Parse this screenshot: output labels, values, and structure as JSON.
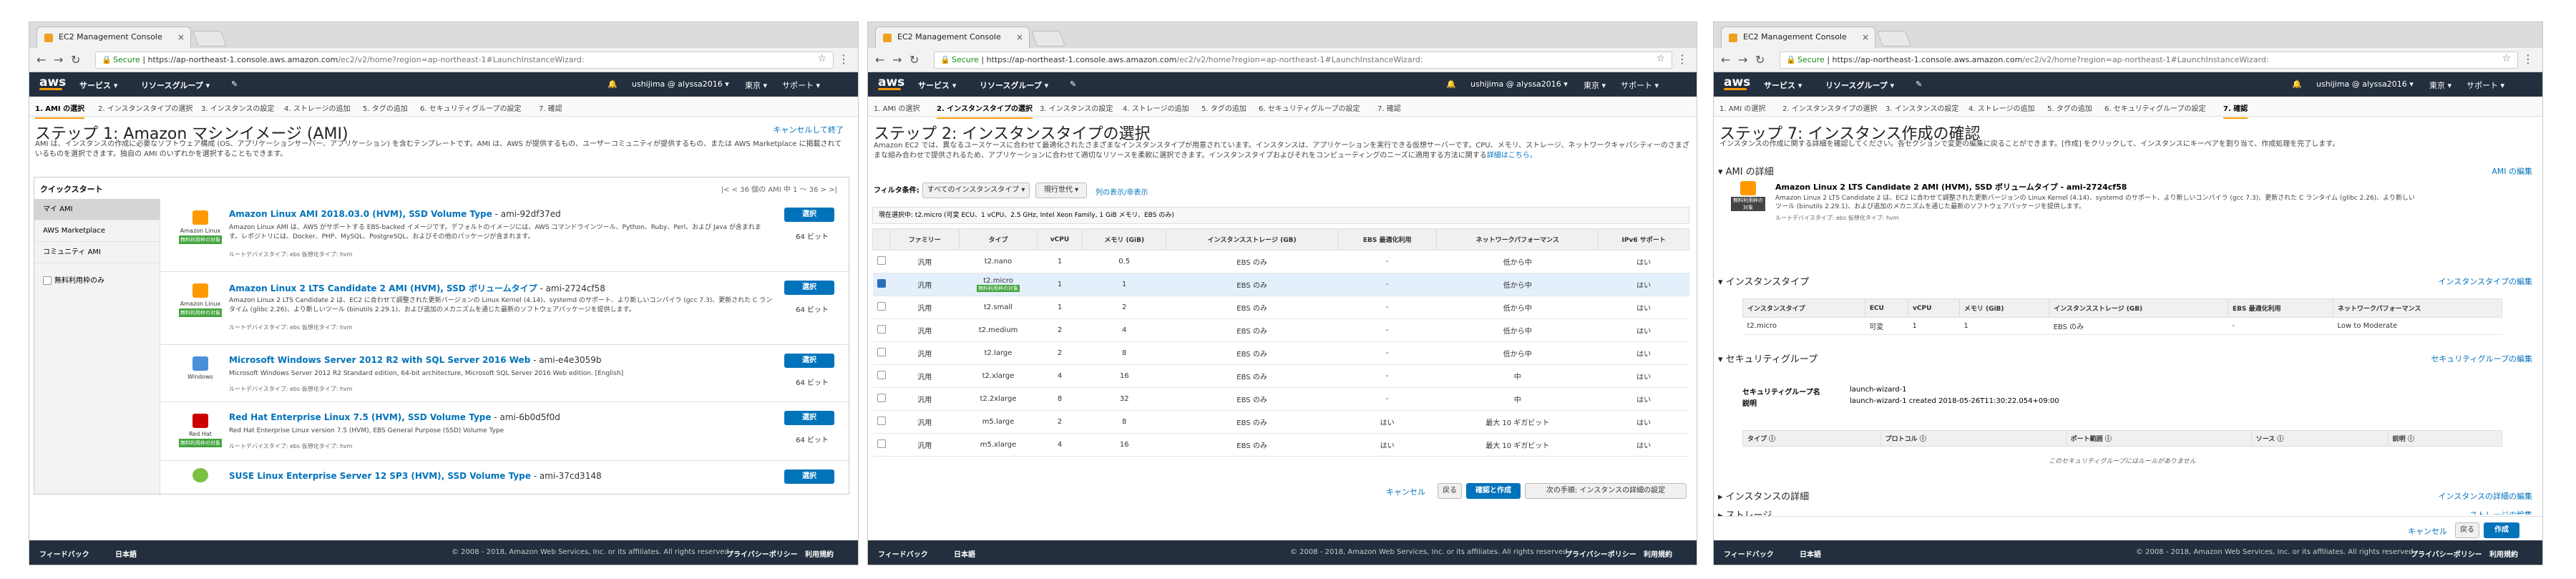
{
  "browser": {
    "tab_title": "EC2 Management Console",
    "tab_close": "×",
    "secure_label": "Secure",
    "url_host": "https://ap-northeast-1.console.aws.amazon.com",
    "url_path": "/ec2/v2/home?region=ap-northeast-1#LaunchInstanceWizard:"
  },
  "awsnav": {
    "logo": "aws",
    "services": "サービス ▾",
    "resource_groups": "リソースグループ ▾",
    "pin": "✎",
    "bell": "🔔",
    "user": "ushijima @ alyssa2016 ▾",
    "region": "東京 ▾",
    "support": "サポート ▾"
  },
  "steps": [
    "1. AMI の選択",
    "2. インスタンスタイプの選択",
    "3. インスタンスの設定",
    "4. ストレージの追加",
    "5. タグの追加",
    "6. セキュリティグループの設定",
    "7. 確認"
  ],
  "footer": {
    "feedback": "フィードバック",
    "language": "日本語",
    "copyright": "© 2008 - 2018, Amazon Web Services, Inc. or its affiliates. All rights reserved.",
    "privacy": "プライバシーポリシー",
    "terms": "利用規約"
  },
  "w1": {
    "title": "ステップ 1: Amazon マシンイメージ (AMI)",
    "cancel": "キャンセルして終了",
    "desc": "AMI は、インスタンスの作成に必要なソフトウェア構成 (OS、アプリケーションサーバー、アプリケーション) を含むテンプレートです。AMI は、AWS が提供するもの、ユーザーコミュニティが提供するもの、または AWS Marketplace に掲載されているものを選択できます。独自の AMI のいずれかを選択することもできます。",
    "pager": "|<  <  36 個の AMI 中 1 〜 36  >  >|",
    "quickstart": "クイックスタート",
    "side": [
      "マイ AMI",
      "AWS Marketplace",
      "コミュニティ AMI",
      "無料利用枠のみ"
    ],
    "amis": [
      {
        "name": "Amazon Linux AMI 2018.03.0 (HVM), SSD Volume Type",
        "id": " - ami-92df37ed",
        "icon_label": "Amazon Linux",
        "badge": "無料利用枠の対象",
        "desc": "Amazon Linux AMI は、AWS がサポートする EBS-backed イメージです。デフォルトのイメージには、AWS コマンドラインツール、Python、Ruby、Perl、および Java が含まれます。レポジトリには、Docker、PHP、MySQL、PostgreSQL、およびその他のパッケージが含まれます。",
        "root": "ルートデバイスタイプ: ebs    仮想化タイプ: hvm",
        "select": "選択",
        "bits": "64 ビット"
      },
      {
        "name": "Amazon Linux 2 LTS Candidate 2 AMI (HVM), SSD ボリュームタイプ",
        "id": " - ami-2724cf58",
        "icon_label": "Amazon Linux",
        "badge": "無料利用枠の対象",
        "desc": "Amazon Linux 2 LTS Candidate 2 は、EC2 に合わせて調整された更新バージョンの Linux Kernel (4.14)、systemd のサポート、より新しいコンパイラ (gcc 7.3)、更新された C ランタイム (glibc 2.26)、より新しいツール (binutils 2.29.1)、および追加のメカニズムを通じた最新のソフトウェアパッケージを提供します。",
        "root": "ルートデバイスタイプ: ebs    仮想化タイプ: hvm",
        "select": "選択",
        "bits": "64 ビット"
      },
      {
        "name": "Microsoft Windows Server 2012 R2 with SQL Server 2016 Web",
        "id": " - ami-e4e3059b",
        "icon_label": "Windows",
        "badge": "",
        "desc": "Microsoft Windows Server 2012 R2 Standard edition, 64-bit architecture, Microsoft SQL Server 2016 Web edition. [English]",
        "root": "ルートデバイスタイプ: ebs    仮想化タイプ: hvm",
        "select": "選択",
        "bits": "64 ビット"
      },
      {
        "name": "Red Hat Enterprise Linux 7.5 (HVM), SSD Volume Type",
        "id": " - ami-6b0d5f0d",
        "icon_label": "Red Hat",
        "badge": "無料利用枠の対象",
        "desc": "Red Hat Enterprise Linux version 7.5 (HVM), EBS General Purpose (SSD) Volume Type",
        "root": "ルートデバイスタイプ: ebs    仮想化タイプ: hvm",
        "select": "選択",
        "bits": "64 ビット"
      },
      {
        "name": "SUSE Linux Enterprise Server 12 SP3 (HVM), SSD Volume Type",
        "id": " - ami-37cd3148",
        "icon_label": "",
        "badge": "",
        "desc": "",
        "root": "",
        "select": "選択",
        "bits": ""
      }
    ]
  },
  "w2": {
    "title": "ステップ 2: インスタンスタイプの選択",
    "desc": "Amazon EC2 では、異なるユースケースに合わせて最適化されたさまざまなインスタンスタイプが用意されています。インスタンスは、アプリケーションを実行できる仮想サーバーです。CPU、メモリ、ストレージ、ネットワークキャパシティーのさまざまな組み合わせで提供されるため、アプリケーションに合わせて適切なリソースを柔軟に選択できます。インスタンスタイプおよびそれをコンピューティングのニーズに適用する方法に関する",
    "desc_link": "詳細はこちら。",
    "filter_label": "フィルタ条件:",
    "filter_value": "すべてのインスタンスタイプ ▾",
    "gen_value": "現行世代 ▾",
    "cols_link": "列の表示/非表示",
    "current": "現在選択中: t2.micro (可変 ECU、1 vCPU、2.5 GHz, Intel Xeon Family, 1 GiB メモリ、EBS のみ)",
    "headers": [
      "ファミリー",
      "タイプ",
      "vCPU",
      "メモリ (GiB)",
      "インスタンスストレージ (GB)",
      "EBS 最適化利用",
      "ネットワークパフォーマンス",
      "IPv6 サポート"
    ],
    "rows": [
      [
        "汎用",
        "t2.nano",
        "1",
        "0.5",
        "EBS のみ",
        "-",
        "低から中",
        "はい"
      ],
      [
        "汎用",
        "t2.micro",
        "1",
        "1",
        "EBS のみ",
        "-",
        "低から中",
        "はい"
      ],
      [
        "汎用",
        "t2.small",
        "1",
        "2",
        "EBS のみ",
        "-",
        "低から中",
        "はい"
      ],
      [
        "汎用",
        "t2.medium",
        "2",
        "4",
        "EBS のみ",
        "-",
        "低から中",
        "はい"
      ],
      [
        "汎用",
        "t2.large",
        "2",
        "8",
        "EBS のみ",
        "-",
        "低から中",
        "はい"
      ],
      [
        "汎用",
        "t2.xlarge",
        "4",
        "16",
        "EBS のみ",
        "-",
        "中",
        "はい"
      ],
      [
        "汎用",
        "t2.2xlarge",
        "8",
        "32",
        "EBS のみ",
        "-",
        "中",
        "はい"
      ],
      [
        "汎用",
        "m5.large",
        "2",
        "8",
        "EBS のみ",
        "はい",
        "最大 10 ギガビット",
        "はい"
      ],
      [
        "汎用",
        "m5.xlarge",
        "4",
        "16",
        "EBS のみ",
        "はい",
        "最大 10 ギガビット",
        "はい"
      ]
    ],
    "free_badge": "無料利用枠の対象",
    "cancel": "キャンセル",
    "back": "戻る",
    "review": "確認と作成",
    "next": "次の手順: インスタンスの詳細の設定"
  },
  "w3": {
    "title": "ステップ 7: インスタンス作成の確認",
    "desc": "インスタンスの作成に関する詳細を確認してください。各セクションで変更の編集に戻ることができます。[作成] をクリックして、インスタンスにキーペアを割り当て、作成処理を完了します。",
    "ami_section": "▾ AMI の詳細",
    "ami_edit": "AMI の編集",
    "ami_name": "Amazon Linux 2 LTS Candidate 2 AMI (HVM), SSD ボリュームタイプ - ami-2724cf58",
    "ami_badge": "無料利用枠の対象",
    "ami_desc": "Amazon Linux 2 LTS Candidate 2 は、EC2 に合わせて調整された更新バージョンの Linux Kernel (4.14)、systemd のサポート、より新しいコンパイラ (gcc 7.3)、更新された C ランタイム (glibc 2.26)、より新しいツール (binutils 2.29.1)、および追加のメカニズムを通じた最新のソフトウェアパッケージを提供します。",
    "ami_root": "ルートデバイスタイプ: ebs    仮想化タイプ: hvm",
    "type_section": "▾ インスタンスタイプ",
    "type_edit": "インスタンスタイプの編集",
    "type_headers": [
      "インスタンスタイプ",
      "ECU",
      "vCPU",
      "メモリ (GiB)",
      "インスタンスストレージ (GB)",
      "EBS 最適化利用",
      "ネットワークパフォーマンス"
    ],
    "type_row": [
      "t2.micro",
      "可変",
      "1",
      "1",
      "EBS のみ",
      "-",
      "Low to Moderate"
    ],
    "sg_section": "▾ セキュリティグループ",
    "sg_edit": "セキュリティグループの編集",
    "sg_name_label": "セキュリティグループ名",
    "sg_name": "launch-wizard-1",
    "sg_desc_label": "説明",
    "sg_desc": "launch-wizard-1 created 2018-05-26T11:30:22.054+09:00",
    "sg_headers": [
      "タイプ ⓘ",
      "プロトコル ⓘ",
      "ポート範囲 ⓘ",
      "ソース ⓘ",
      "説明 ⓘ"
    ],
    "sg_empty": "このセキュリティグループにはルールがありません",
    "detail_section": "▸ インスタンスの詳細",
    "detail_edit": "インスタンスの詳細の編集",
    "storage_section": "▸ ストレージ",
    "storage_edit": "ストレージの編集",
    "cancel": "キャンセル",
    "back": "戻る",
    "launch": "作成"
  }
}
